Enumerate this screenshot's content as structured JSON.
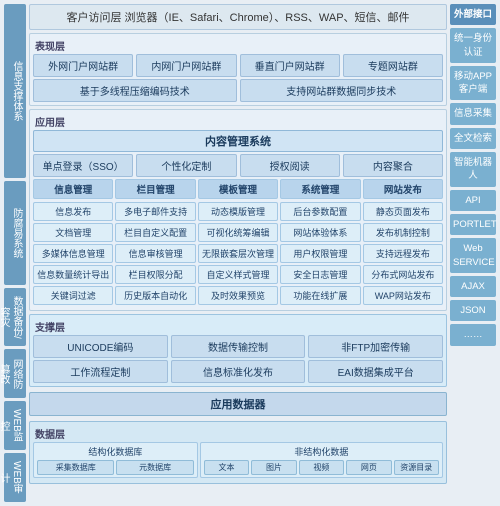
{
  "left_sidebar": {
    "labels": [
      {
        "id": "info-support",
        "text": "信息支撑体系",
        "size": "tall"
      },
      {
        "id": "anti-intrusion",
        "text": "防腐易系统",
        "size": "medium"
      },
      {
        "id": "data-backup",
        "text": "数据备份/容灾",
        "size": "short"
      },
      {
        "id": "network-defense",
        "text": "网络防篡改",
        "size": "short"
      },
      {
        "id": "web-monitor",
        "text": "WEB监控",
        "size": "short"
      },
      {
        "id": "web-audit",
        "text": "WEB审计",
        "size": "short"
      }
    ]
  },
  "top_bar": {
    "text": "客户访问层  浏览器（IE、Safari、Chrome）、RSS、WAP、短信、邮件"
  },
  "presentation_layer": {
    "label": "表现层",
    "items": [
      "外网门户网站群",
      "内网门户网站群",
      "垂直门户网站群",
      "专题网站群"
    ]
  },
  "tech_base": {
    "item1": "基于多线程压缩编码技术",
    "item2": "支持网站群数据同步技术"
  },
  "app_layer": {
    "label": "应用层",
    "cms_title": "内容管理系统",
    "sso": "单点登录（SSO）",
    "personalize": "个性化定制",
    "auth_read": "授权阅读",
    "content_agg": "内容聚合",
    "sub_items": [
      {
        "header": "信息管理",
        "lines": [
          "信息发布",
          "文档管理",
          "多媒体信息管理",
          "信息数量统计导出",
          "关键词过滤"
        ]
      },
      {
        "header": "栏目管理",
        "lines": [
          "多电子邮件支持",
          "栏目自定义配置",
          "信息审核管理",
          "栏目权限分配",
          "历史版本自动化"
        ]
      },
      {
        "header": "模板管理",
        "lines": [
          "动态模版管理",
          "可视化统筹编辑",
          "无限嵌套层次管理",
          "自定义样式管理",
          "及时效果预览"
        ]
      },
      {
        "header": "系统管理",
        "lines": [
          "后台参数配置",
          "网站体验体系",
          "用户权限管理",
          "安全日志管理",
          "功能在线扩展"
        ]
      },
      {
        "header": "网站发布",
        "lines": [
          "静态页面发布",
          "发布机制控制",
          "支持远程发布",
          "分布式网站发布",
          "WAP网站发布"
        ]
      }
    ]
  },
  "support_layer": {
    "label": "支撑层",
    "row1": [
      "UNICODE编码",
      "数据传输控制",
      "非FTP加密传输"
    ],
    "row2": [
      "工作流程定制",
      "信息标准化发布",
      "EAI数据集成平台"
    ]
  },
  "app_data": {
    "title": "应用数据器"
  },
  "data_layer": {
    "label": "数据层",
    "structured": {
      "title": "结构化数据库",
      "sub": [
        "采集数据库",
        "元数据库"
      ]
    },
    "unstructured": {
      "title": "非结构化数据",
      "sub": [
        "文本",
        "图片",
        "视频",
        "网页",
        "资源目录"
      ]
    }
  },
  "right_sidebar": {
    "top_label": "外部接口",
    "items": [
      "统一身份认证",
      "移动APP客户端",
      "信息采集",
      "全文检索",
      "智能机器人",
      "API",
      "PORTLET",
      "Web SERVICE",
      "AJAX",
      "JSON",
      "……"
    ]
  }
}
